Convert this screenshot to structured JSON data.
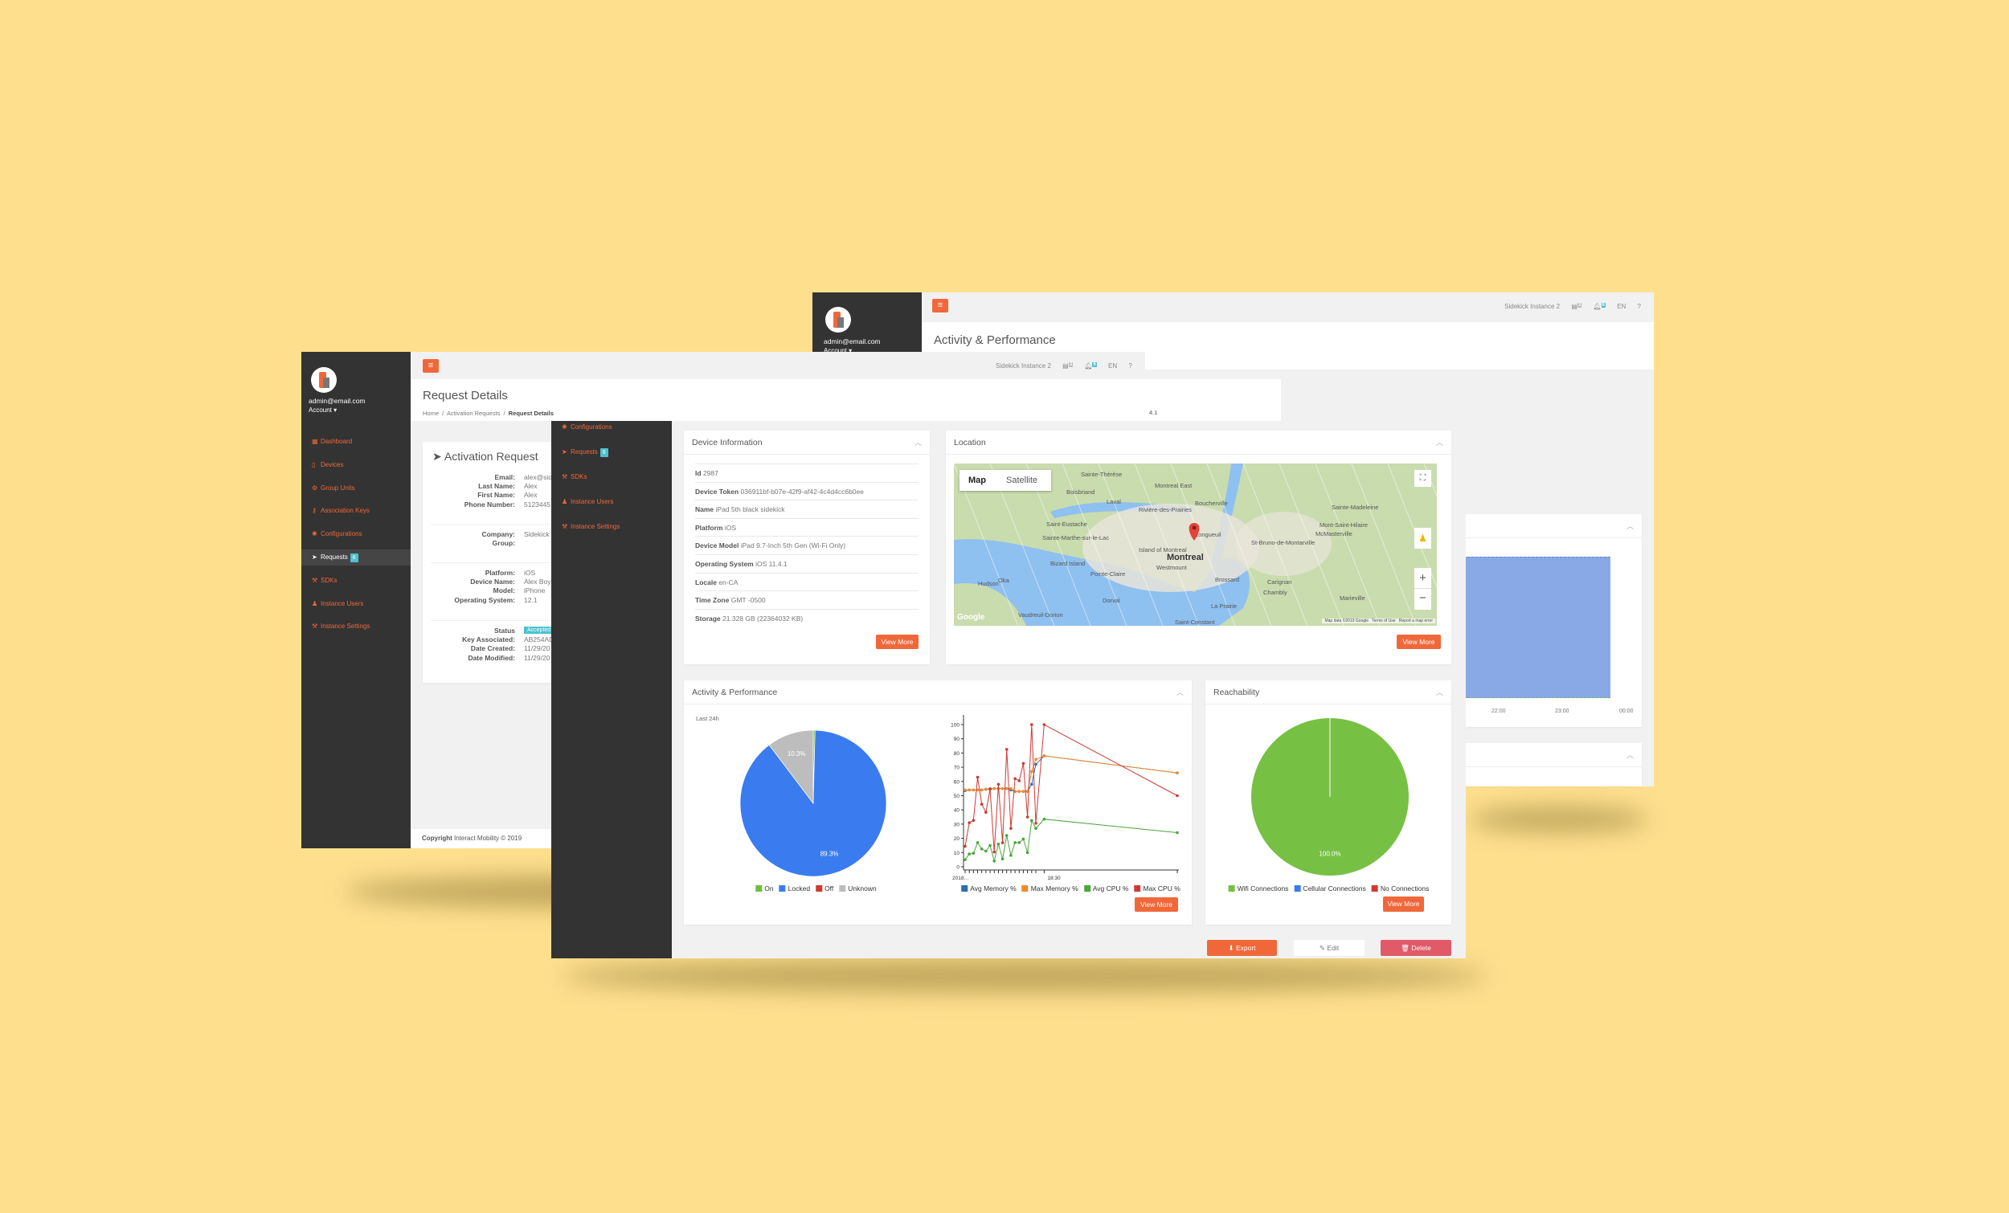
{
  "colors": {
    "background": "#fddf8e",
    "accent": "#f0683a",
    "sidebar": "#333333",
    "badge": "#4fc1cf",
    "danger": "#e05a68"
  },
  "user": {
    "email": "admin@email.com",
    "account": "Account ▾"
  },
  "topbar": {
    "menu_icon": "hamburger-icon",
    "instance": "Sidekick Instance 2",
    "tasks_count": "3",
    "notifications_count": "6",
    "language": "EN",
    "help": "?"
  },
  "back_window": {
    "title": "Activity & Performance",
    "chart": {
      "type": "area",
      "x_ticks": [
        "22:00",
        "23:00",
        "00:00"
      ],
      "fill": "#89a9e6"
    }
  },
  "left_window": {
    "title": "Request Details",
    "breadcrumb": [
      "Home",
      "Activation Requests",
      "Request Details"
    ],
    "peek_text": "4.1",
    "sidebar": [
      {
        "label": "Dashboard",
        "icon": "dashboard-icon",
        "glyph": "▦"
      },
      {
        "label": "Devices",
        "icon": "mobile-icon",
        "glyph": "▯"
      },
      {
        "label": "Group Units",
        "icon": "group-icon",
        "glyph": "⚙"
      },
      {
        "label": "Association Keys",
        "icon": "key-icon",
        "glyph": "⚷"
      },
      {
        "label": "Configurations",
        "icon": "gear-icon",
        "glyph": "✺"
      },
      {
        "label": "Requests",
        "icon": "paper-plane-icon",
        "glyph": "➤",
        "badge": "6",
        "active": true
      },
      {
        "label": "SDKs",
        "icon": "wrench-icon",
        "glyph": "⚒"
      },
      {
        "label": "Instance Users",
        "icon": "user-icon",
        "glyph": "♟"
      },
      {
        "label": "Instance Settings",
        "icon": "wrench-icon",
        "glyph": "⚒"
      }
    ],
    "card": {
      "title": "Activation Request",
      "groups": [
        [
          {
            "k": "Email:",
            "v": "alex@sid"
          },
          {
            "k": "Last Name:",
            "v": "Alex"
          },
          {
            "k": "First Name:",
            "v": "Alex"
          },
          {
            "k": "Phone Number:",
            "v": "5123445"
          }
        ],
        [
          {
            "k": "Company:",
            "v": "Sidekick"
          },
          {
            "k": "Group:",
            "v": ""
          }
        ],
        [
          {
            "k": "Platform:",
            "v": "iOS"
          },
          {
            "k": "Device Name:",
            "v": "Alex Boy"
          },
          {
            "k": "Model:",
            "v": "iPhone"
          },
          {
            "k": "Operating System:",
            "v": "12.1"
          }
        ],
        [
          {
            "k": "Status",
            "v": "Accepted",
            "badge": true
          },
          {
            "k": "Key Associated:",
            "v": "AB254AD"
          },
          {
            "k": "Date Created:",
            "v": "11/29/20"
          },
          {
            "k": "Date Modified:",
            "v": "11/29/20"
          }
        ]
      ]
    },
    "footer": {
      "bold": "Copyright",
      "text": "Interact Mobility © 2019"
    }
  },
  "front_window": {
    "sidebar": [
      {
        "label": "Configurations",
        "icon": "gear-icon",
        "glyph": "✺"
      },
      {
        "label": "Requests",
        "icon": "paper-plane-icon",
        "glyph": "➤",
        "badge": "6"
      },
      {
        "label": "SDKs",
        "icon": "wrench-icon",
        "glyph": "⚒"
      },
      {
        "label": "Instance Users",
        "icon": "user-icon",
        "glyph": "♟"
      },
      {
        "label": "Instance Settings",
        "icon": "wrench-icon",
        "glyph": "⚒"
      }
    ],
    "device_info": {
      "title": "Device Information",
      "rows": [
        {
          "k": "Id",
          "v": "2987"
        },
        {
          "k": "Device Token",
          "v": "036911bf-b07e-42f9-af42-4c4d4cc6b0ee"
        },
        {
          "k": "Name",
          "v": "iPad 5th black sidekick"
        },
        {
          "k": "Platform",
          "v": "iOS"
        },
        {
          "k": "Device Model",
          "v": "iPad 9.7-Inch 5th Gen (Wi-Fi Only)"
        },
        {
          "k": "Operating System",
          "v": "iOS 11.4.1"
        },
        {
          "k": "Locale",
          "v": "en-CA"
        },
        {
          "k": "Time Zone",
          "v": "GMT -0500"
        },
        {
          "k": "Storage",
          "v": "21.328 GB (22364032 KB)"
        }
      ],
      "button": "View More"
    },
    "location": {
      "title": "Location",
      "map_type": [
        "Map",
        "Satellite"
      ],
      "labels": [
        "Sainte-Thérèse",
        "Boisbriand",
        "Laval",
        "Montreal East",
        "Boucherville",
        "Sainte-Madeleine",
        "Saint-Eustache",
        "Mont-Saint-Hilaire",
        "McMasterville",
        "Longueuil",
        "Sainte-Marthe-sur-le-Lac",
        "St-Bruno-de-Montarville",
        "Island of Montreal",
        "Montreal",
        "Westmount",
        "Bizard Island",
        "Pointe-Claire",
        "Brossard",
        "Carignan",
        "Hudson",
        "Oka",
        "Dorval",
        "Chambly",
        "Marieville",
        "Vaudreuil-Dorion",
        "La Prairie",
        "Saint-Constant",
        "Rivière-des-Prairies"
      ],
      "attribution": "Map data ©2019 Google",
      "terms": "Terms of Use",
      "report": "Report a map error",
      "logo": "Google",
      "zoom_in": "+",
      "zoom_out": "−",
      "button": "View More"
    },
    "activity": {
      "title": "Activity & Performance",
      "subtitle": "Last 24h",
      "button": "View More"
    },
    "reachability": {
      "title": "Reachability",
      "button": "View More"
    },
    "actions": {
      "export": "⬇ Export",
      "edit": "✎ Edit",
      "delete": "🗑 Delete"
    }
  },
  "chart_data": [
    {
      "type": "pie",
      "slices": [
        {
          "name": "On",
          "value": 0.4,
          "color": "#6dbf3a"
        },
        {
          "name": "Locked",
          "value": 89.3,
          "color": "#3a7bef",
          "label": "89.3%"
        },
        {
          "name": "Off",
          "value": 0,
          "color": "#cf3a2d"
        },
        {
          "name": "Unknown",
          "value": 10.3,
          "color": "#bdbdbd",
          "label": "10.3%"
        }
      ]
    },
    {
      "type": "line",
      "ylim": [
        0,
        100
      ],
      "y_ticks": [
        0,
        10,
        20,
        30,
        40,
        50,
        60,
        70,
        80,
        90,
        100
      ],
      "x_tick_labels": [
        "2018…",
        "18:30"
      ],
      "x": [
        0,
        1,
        2,
        3,
        4,
        5,
        6,
        7,
        8,
        9,
        10,
        11,
        12,
        13,
        14,
        15,
        16,
        17,
        19,
        51
      ],
      "series": [
        {
          "name": "Avg Memory %",
          "color": "#2f6db5",
          "values": [
            53.5,
            54,
            54,
            54,
            54,
            54.5,
            54.5,
            55,
            55,
            55,
            55,
            54,
            53,
            53,
            53,
            53,
            58,
            72,
            78,
            66
          ]
        },
        {
          "name": "Max Memory %",
          "color": "#f18a2b",
          "values": [
            54,
            54,
            54,
            54,
            54,
            54.5,
            55,
            55,
            55,
            55,
            55,
            55,
            53,
            53,
            53,
            53,
            67,
            75.5,
            78,
            66
          ]
        },
        {
          "name": "Avg CPU %",
          "color": "#4aa63b",
          "values": [
            5,
            9,
            9.5,
            17,
            12.5,
            11,
            15,
            4,
            16,
            5.5,
            22,
            8,
            17,
            17,
            19.5,
            10,
            32.5,
            27,
            33.5,
            24
          ]
        },
        {
          "name": "Max CPU %",
          "color": "#cc3a35",
          "values": [
            14.4,
            31,
            32.6,
            63,
            44,
            38.3,
            54.8,
            10.4,
            58,
            16.9,
            82.5,
            27,
            62,
            60.5,
            72.7,
            35,
            100,
            30.6,
            100,
            50
          ]
        }
      ]
    },
    {
      "type": "pie",
      "slices": [
        {
          "name": "Wifi Connections",
          "value": 100,
          "color": "#76c043",
          "label": "100.0%"
        },
        {
          "name": "Cellular Connections",
          "value": 0,
          "color": "#3a7bef"
        },
        {
          "name": "No Connections",
          "value": 0,
          "color": "#cf3a2d"
        }
      ]
    }
  ]
}
